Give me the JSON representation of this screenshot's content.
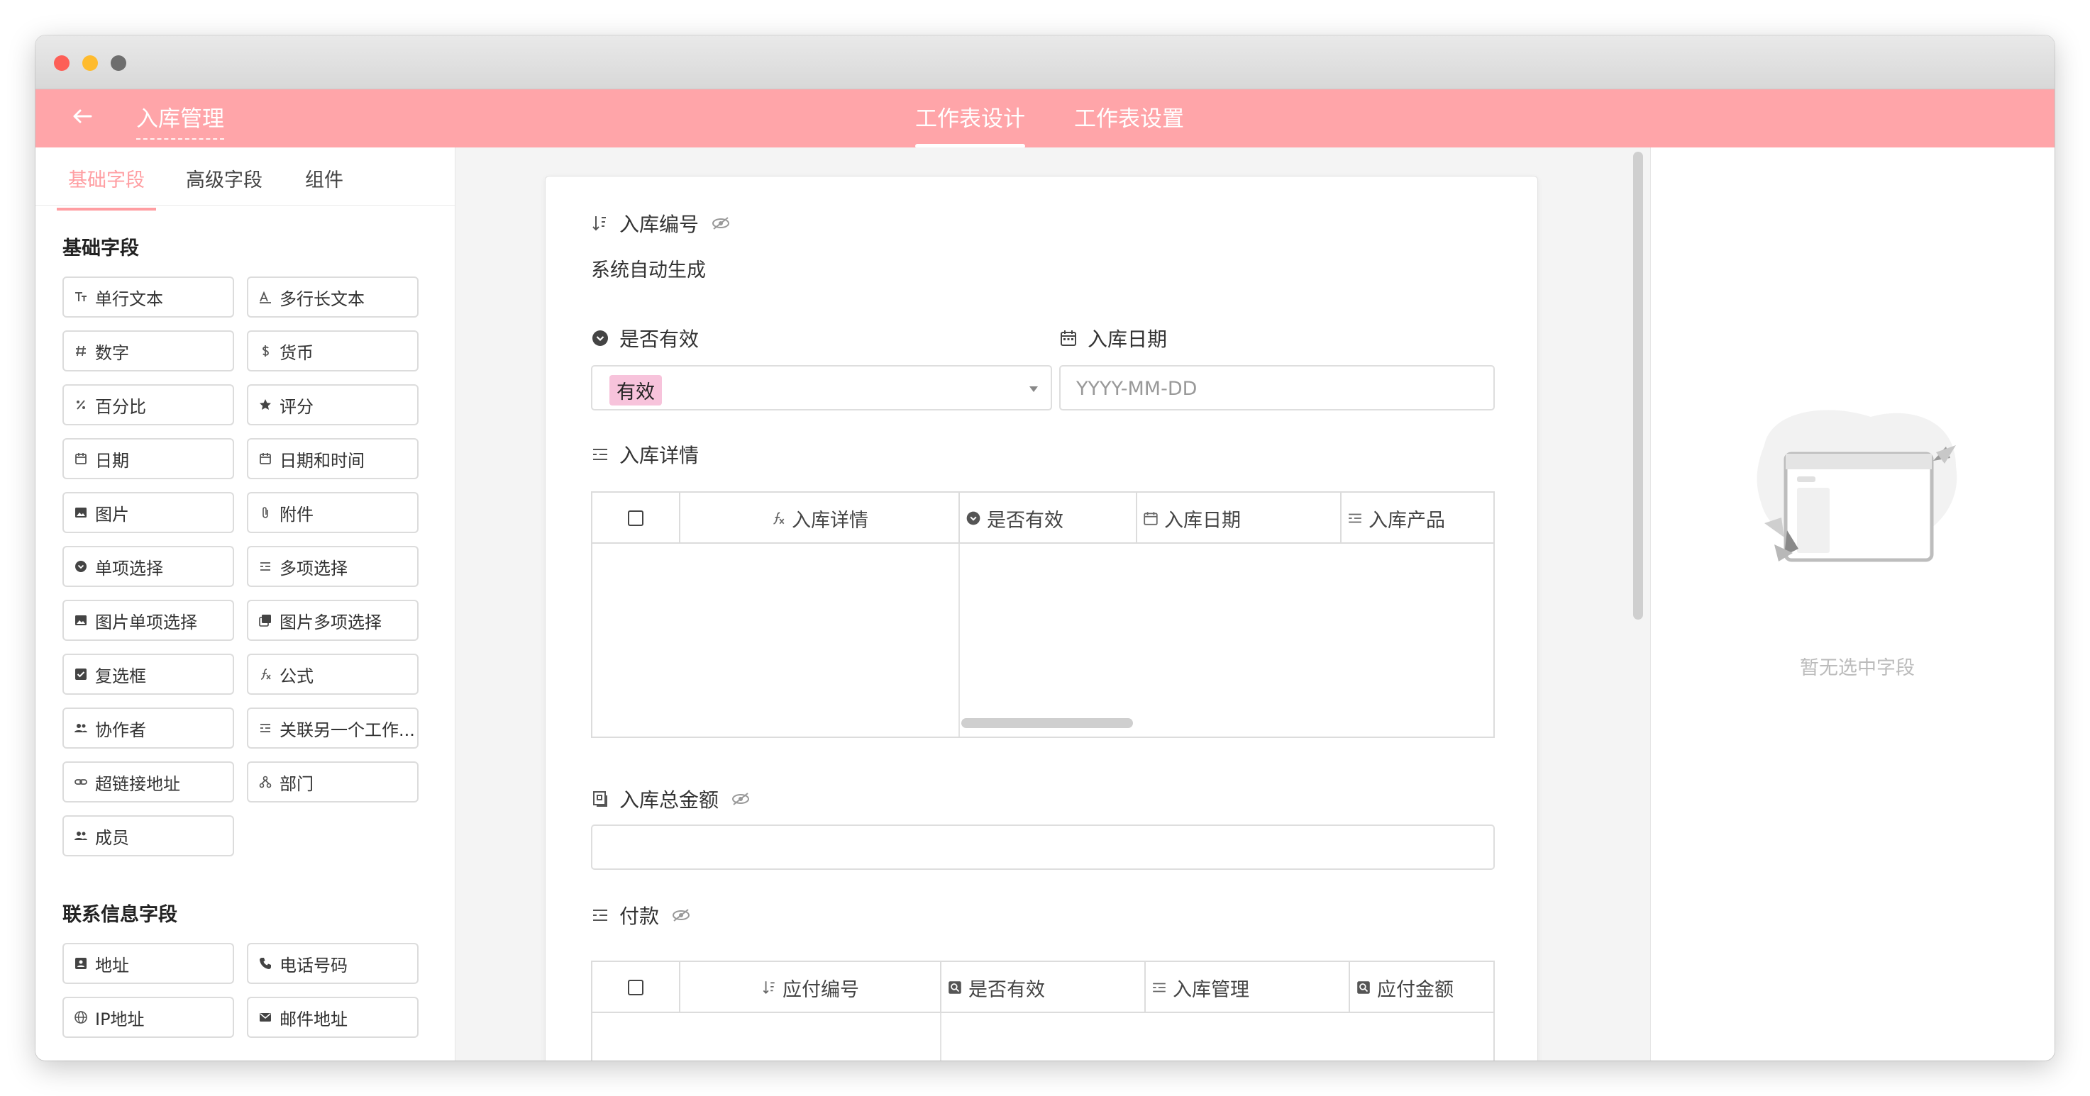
{
  "app": {
    "title": "入库管理",
    "tabs": [
      {
        "label": "工作表设计",
        "active": true
      },
      {
        "label": "工作表设置",
        "active": false
      }
    ],
    "accent": "#ffa5a9"
  },
  "left": {
    "tabs": [
      {
        "label": "基础字段",
        "active": true
      },
      {
        "label": "高级字段",
        "active": false
      },
      {
        "label": "组件",
        "active": false
      }
    ],
    "basic_section": "基础字段",
    "basic_fields": [
      {
        "label": "单行文本",
        "icon": "text-icon"
      },
      {
        "label": "多行长文本",
        "icon": "multiline-icon"
      },
      {
        "label": "数字",
        "icon": "hash-icon"
      },
      {
        "label": "货币",
        "icon": "dollar-icon"
      },
      {
        "label": "百分比",
        "icon": "percent-icon"
      },
      {
        "label": "评分",
        "icon": "star-icon"
      },
      {
        "label": "日期",
        "icon": "calendar-icon"
      },
      {
        "label": "日期和时间",
        "icon": "calendar-icon"
      },
      {
        "label": "图片",
        "icon": "image-icon"
      },
      {
        "label": "附件",
        "icon": "paperclip-icon"
      },
      {
        "label": "单项选择",
        "icon": "radio-icon"
      },
      {
        "label": "多项选择",
        "icon": "list-icon"
      },
      {
        "label": "图片单项选择",
        "icon": "image-icon"
      },
      {
        "label": "图片多项选择",
        "icon": "images-icon"
      },
      {
        "label": "复选框",
        "icon": "checkbox-icon"
      },
      {
        "label": "公式",
        "icon": "formula-icon"
      },
      {
        "label": "协作者",
        "icon": "people-icon"
      },
      {
        "label": "关联另一个工作...",
        "icon": "list-icon"
      },
      {
        "label": "超链接地址",
        "icon": "link-icon"
      },
      {
        "label": "部门",
        "icon": "org-icon"
      },
      {
        "label": "成员",
        "icon": "people-icon"
      }
    ],
    "contact_section": "联系信息字段",
    "contact_fields": [
      {
        "label": "地址",
        "icon": "address-icon"
      },
      {
        "label": "电话号码",
        "icon": "phone-icon"
      },
      {
        "label": "IP地址",
        "icon": "globe-icon"
      },
      {
        "label": "邮件地址",
        "icon": "mail-icon"
      }
    ]
  },
  "form": {
    "serial": {
      "label": "入库编号",
      "value": "系统自动生成"
    },
    "valid": {
      "label": "是否有效",
      "value": "有效"
    },
    "date": {
      "label": "入库日期",
      "placeholder": "YYYY-MM-DD"
    },
    "detail": {
      "label": "入库详情",
      "columns": [
        {
          "label": "入库详情",
          "icon": "formula-icon"
        },
        {
          "label": "是否有效",
          "icon": "radio-icon"
        },
        {
          "label": "入库日期",
          "icon": "calendar-icon"
        },
        {
          "label": "入库产品",
          "icon": "list-icon"
        }
      ]
    },
    "total": {
      "label": "入库总金额"
    },
    "payment": {
      "label": "付款",
      "columns": [
        {
          "label": "应付编号",
          "icon": "sort-icon"
        },
        {
          "label": "是否有效",
          "icon": "lookup-icon"
        },
        {
          "label": "入库管理",
          "icon": "list-icon"
        },
        {
          "label": "应付金额",
          "icon": "lookup-icon"
        }
      ]
    }
  },
  "right": {
    "empty_text": "暂无选中字段"
  }
}
